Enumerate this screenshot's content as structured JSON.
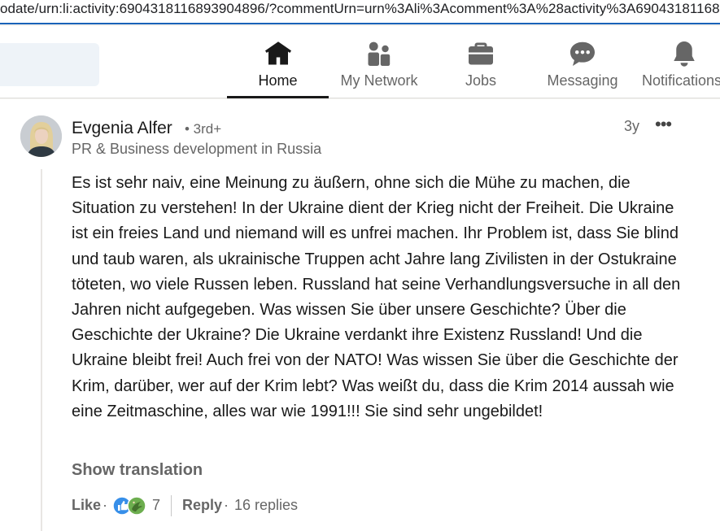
{
  "browser": {
    "url": "odate/urn:li:activity:6904318116893904896/?commentUrn=urn%3Ali%3Acomment%3A%28activity%3A690431811689"
  },
  "nav": {
    "items": [
      {
        "label": "Home",
        "icon": "home-icon",
        "active": true
      },
      {
        "label": "My Network",
        "icon": "network-icon"
      },
      {
        "label": "Jobs",
        "icon": "briefcase-icon"
      },
      {
        "label": "Messaging",
        "icon": "messaging-icon"
      },
      {
        "label": "Notifications",
        "icon": "bell-icon"
      }
    ]
  },
  "comment": {
    "author": "Evgenia Alfer",
    "degree": "• 3rd+",
    "headline": "PR & Business development in Russia",
    "time": "3y",
    "more": "•••",
    "text": "Es ist sehr naiv, eine Meinung zu äußern, ohne sich die Mühe zu machen, die Situation zu verstehen! In der Ukraine dient der Krieg nicht der Freiheit. Die Ukraine ist ein freies Land und niemand will es unfrei machen. Ihr Problem ist, dass Sie blind und taub waren, als ukrainische Truppen acht Jahre lang Zivilisten in der Ostukraine töteten, wo viele Russen leben. Russland hat seine Verhandlungsversuche in all den Jahren nicht aufgegeben. Was wissen Sie über unsere Geschichte? Über die Geschichte der Ukraine? Die Ukraine verdankt ihre Existenz Russland! Und die Ukraine bleibt frei! Auch frei von der NATO! Was wissen Sie über die Geschichte der Krim, darüber, wer auf der Krim lebt? Was weißt du, dass die Krim 2014 aussah wie eine Zeitmaschine, alles war wie 1991!!! Sie sind sehr ungebildet!",
    "translate": "Show translation",
    "like": "Like",
    "dot": "·",
    "reaction_count": "7",
    "reactions": [
      "like-reaction-icon",
      "celebrate-reaction-icon"
    ],
    "reply": "Reply",
    "replies": "16 replies"
  },
  "colors": {
    "accent": "#0a66c2",
    "celebrate": "#44712e"
  }
}
